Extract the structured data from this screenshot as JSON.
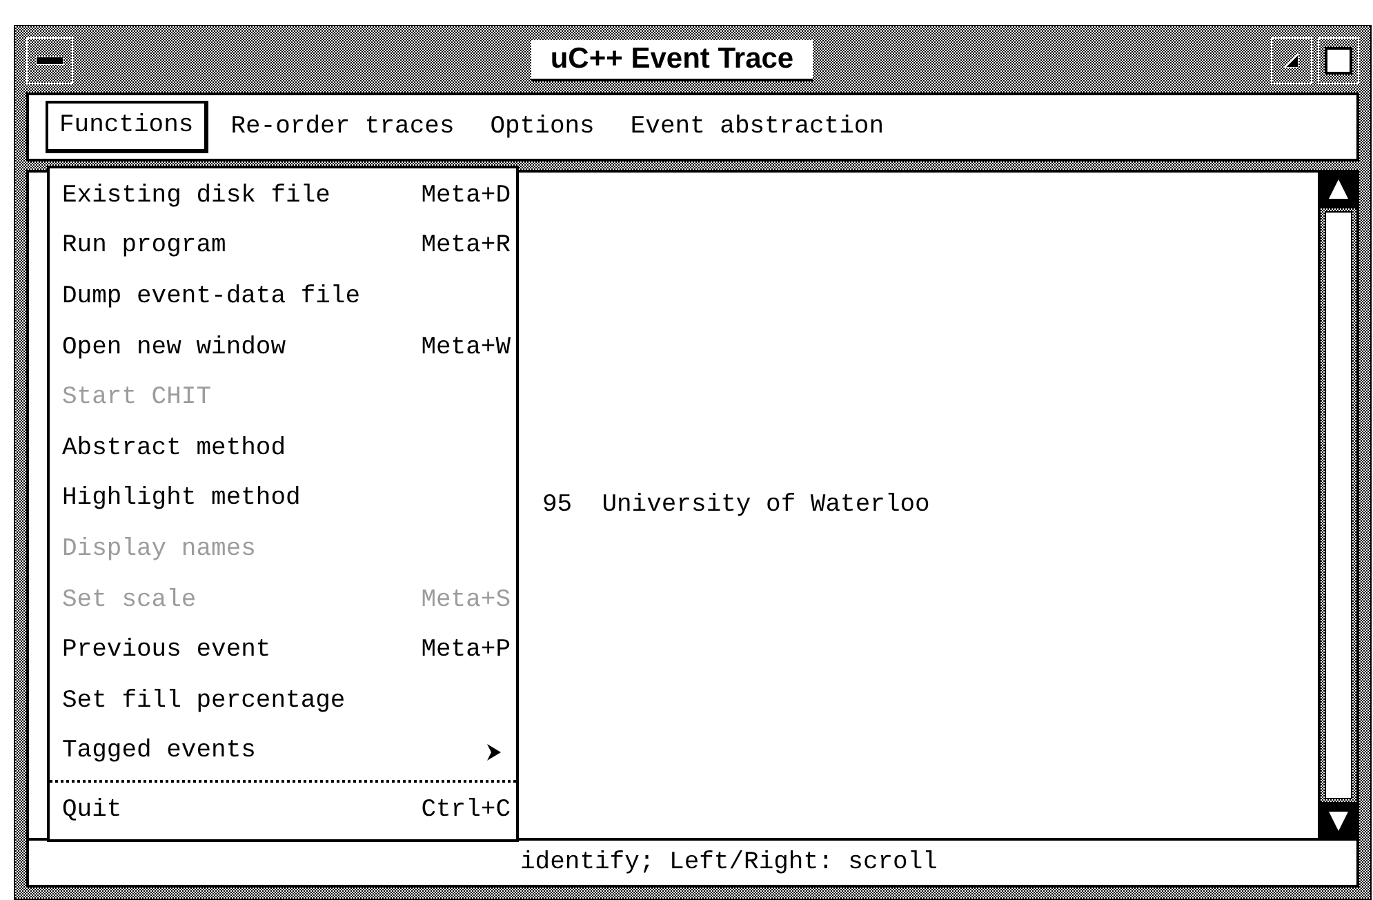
{
  "window": {
    "title": "uC++ Event Trace"
  },
  "menu_bar": [
    {
      "label": "Functions",
      "selected": true
    },
    {
      "label": "Re-order traces",
      "selected": false
    },
    {
      "label": "Options",
      "selected": false
    },
    {
      "label": "Event abstraction",
      "selected": false
    }
  ],
  "functions_menu": [
    {
      "kind": "item",
      "label": "Existing disk file",
      "shortcut": "Meta+D",
      "disabled": false
    },
    {
      "kind": "item",
      "label": "Run program",
      "shortcut": "Meta+R",
      "disabled": false
    },
    {
      "kind": "item",
      "label": "Dump event-data file",
      "disabled": false
    },
    {
      "kind": "item",
      "label": "Open new window",
      "shortcut": "Meta+W",
      "disabled": false
    },
    {
      "kind": "item",
      "label": "Start CHIT",
      "disabled": true
    },
    {
      "kind": "item",
      "label": "Abstract method",
      "disabled": false
    },
    {
      "kind": "item",
      "label": "Highlight method",
      "disabled": false
    },
    {
      "kind": "item",
      "label": "Display names",
      "disabled": true
    },
    {
      "kind": "item",
      "label": "Set scale",
      "shortcut": "Meta+S",
      "disabled": true
    },
    {
      "kind": "item",
      "label": "Previous event",
      "shortcut": "Meta+P",
      "disabled": false
    },
    {
      "kind": "item",
      "label": "Set fill percentage",
      "disabled": false
    },
    {
      "kind": "submenu",
      "label": "Tagged events",
      "disabled": false
    },
    {
      "kind": "separator"
    },
    {
      "kind": "item",
      "label": "Quit",
      "shortcut": "Ctrl+C",
      "disabled": false
    }
  ],
  "trace_text": "95  University of Waterloo",
  "status_line": "identify; Left/Right: scroll"
}
